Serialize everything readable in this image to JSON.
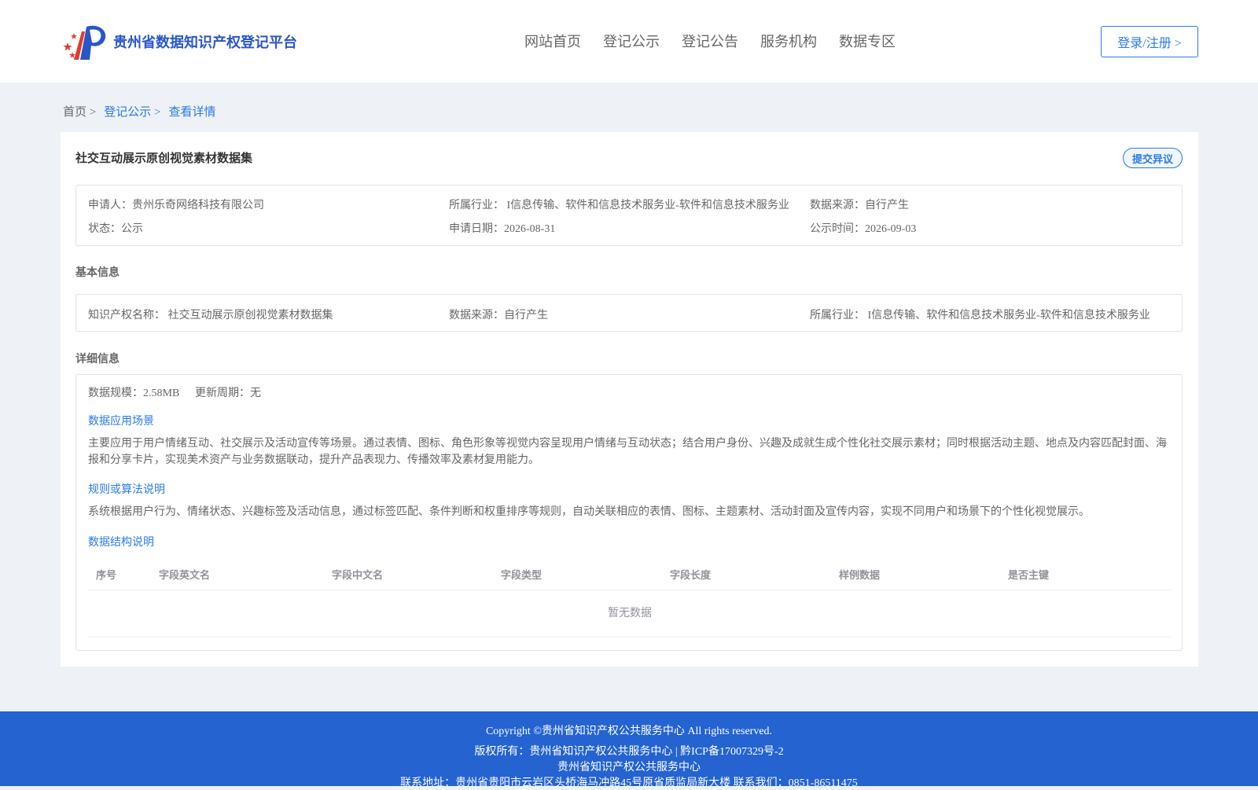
{
  "header": {
    "site_name": "贵州省数据知识产权登记平台",
    "nav": [
      "网站首页",
      "登记公示",
      "登记公告",
      "服务机构",
      "数据专区"
    ],
    "login": "登录/注册 >"
  },
  "breadcrumb": {
    "home": "首页 >",
    "list": "登记公示 >",
    "current": "查看详情"
  },
  "record": {
    "title": "社交互动展示原创视觉素材数据集",
    "objection_button": "提交异议",
    "applicant": "申请人：贵州乐奇网络科技有限公司",
    "industry": "所属行业： I信息传输、软件和信息技术服务业-软件和信息技术服务业",
    "data_source": "数据来源：自行产生",
    "status": "状态：公示",
    "apply_date": "申请日期：2026-08-31",
    "publish_time": "公示时间：2026-09-03"
  },
  "basic_info": {
    "heading": "基本信息",
    "ip_name": "知识产权名称： 社交互动展示原创视觉素材数据集",
    "data_source": "数据来源：自行产生",
    "industry": "所属行业： I信息传输、软件和信息技术服务业-软件和信息技术服务业"
  },
  "detail_info": {
    "heading": "详细信息",
    "scale": "数据规模：2.58MB",
    "update_cycle": "更新周期：无",
    "scenario_heading": "数据应用场景",
    "scenario_text": "主要应用于用户情绪互动、社交展示及活动宣传等场景。通过表情、图标、角色形象等视觉内容呈现用户情绪与互动状态；结合用户身份、兴趣及成就生成个性化社交展示素材；同时根据活动主题、地点及内容匹配封面、海报和分享卡片，实现美术资产与业务数据联动，提升产品表现力、传播效率及素材复用能力。",
    "rules_heading": "规则或算法说明",
    "rules_text": "系统根据用户行为、情绪状态、兴趣标签及活动信息，通过标签匹配、条件判断和权重排序等规则，自动关联相应的表情、图标、主题素材、活动封面及宣传内容，实现不同用户和场景下的个性化视觉展示。",
    "structure_heading": "数据结构说明",
    "table_columns": [
      "序号",
      "字段英文名",
      "字段中文名",
      "字段类型",
      "字段长度",
      "样例数据",
      "是否主键"
    ],
    "empty_text": "暂无数据"
  },
  "footer": {
    "copyright": "Copyright ©贵州省知识产权公共服务中心 All rights reserved.",
    "owner": "版权所有：贵州省知识产权公共服务中心 | 黔ICP备17007329号-2",
    "org": "贵州省知识产权公共服务中心",
    "contact": "联系地址：贵州省贵阳市云岩区头桥海马冲路45号原省质监局新大楼 联系我们：0851-86511475"
  }
}
